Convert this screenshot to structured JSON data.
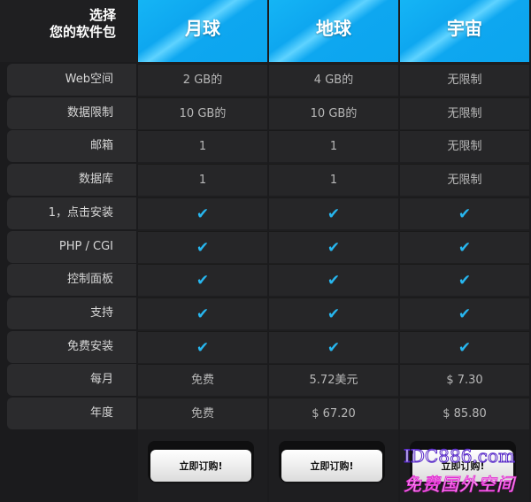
{
  "header": {
    "corner_line1": "选择",
    "corner_line2": "您的软件包",
    "plans": [
      "月球",
      "地球",
      "宇宙"
    ]
  },
  "rows": [
    {
      "label": "Web空间",
      "values": [
        "2 GB的",
        "4 GB的",
        "无限制"
      ]
    },
    {
      "label": "数据限制",
      "values": [
        "10 GB的",
        "10 GB的",
        "无限制"
      ]
    },
    {
      "label": "邮箱",
      "values": [
        "1",
        "1",
        "无限制"
      ]
    },
    {
      "label": "数据库",
      "values": [
        "1",
        "1",
        "无限制"
      ]
    },
    {
      "label": "1，点击安装",
      "values": [
        "✔",
        "✔",
        "✔"
      ]
    },
    {
      "label": "PHP / CGI",
      "values": [
        "✔",
        "✔",
        "✔"
      ]
    },
    {
      "label": "控制面板",
      "values": [
        "✔",
        "✔",
        "✔"
      ]
    },
    {
      "label": "支持",
      "values": [
        "✔",
        "✔",
        "✔"
      ]
    },
    {
      "label": "免费安装",
      "values": [
        "✔",
        "✔",
        "✔"
      ]
    },
    {
      "label": "每月",
      "values": [
        "免费",
        "5.72美元",
        "$ 7.30"
      ]
    },
    {
      "label": "年度",
      "values": [
        "免费",
        "$ 67.20",
        "$ 85.80"
      ]
    }
  ],
  "buttons": {
    "order_label": "立即订购!"
  },
  "watermark": {
    "line1": "IDC886.com",
    "line2": "免费国外空间"
  },
  "colors": {
    "accent": "#0ea7f0",
    "check": "#27b7f0"
  }
}
